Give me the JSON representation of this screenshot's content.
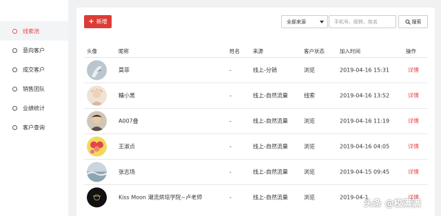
{
  "sidebar": {
    "items": [
      {
        "label": "线索池",
        "active": true
      },
      {
        "label": "意向客户",
        "active": false
      },
      {
        "label": "成交客户",
        "active": false
      },
      {
        "label": "销售团队",
        "active": false
      },
      {
        "label": "业绩统计",
        "active": false
      },
      {
        "label": "客户查询",
        "active": false
      }
    ]
  },
  "toolbar": {
    "add_label": "新增",
    "source_select": "全部来源",
    "search_placeholder": "手机号、昵称、姓名",
    "search_label": "搜索"
  },
  "table": {
    "headers": [
      "头像",
      "昵称",
      "姓名",
      "来源",
      "客户状态",
      "加入时间",
      "操作"
    ],
    "rows": [
      {
        "nickname": "莫菲",
        "name": "-",
        "source": "线上-分销",
        "status": "浏览",
        "joined": "2019-04-16 15:31",
        "action": "详情"
      },
      {
        "nickname": "糖小黑",
        "name": "-",
        "source": "线上-自然流量",
        "status": "线索",
        "joined": "2019-04-16 13:52",
        "action": "详情"
      },
      {
        "nickname": "A007叠",
        "name": "-",
        "source": "线上-自然流量",
        "status": "浏览",
        "joined": "2019-04-16 11:19",
        "action": "详情"
      },
      {
        "nickname": "王淑贞",
        "name": "-",
        "source": "线上-自然流量",
        "status": "浏览",
        "joined": "2019-04-16 04:05",
        "action": "详情"
      },
      {
        "nickname": "张志场",
        "name": "-",
        "source": "线上-自然流量",
        "status": "浏览",
        "joined": "2019-04-15 09:45",
        "action": "详情"
      },
      {
        "nickname": "Kiss Moon 潮流烘培学院~卢老师",
        "name": "-",
        "source": "线上-自然流量",
        "status": "浏览",
        "joined": "2019-04-1",
        "action": "详情"
      }
    ]
  },
  "watermark": "头条 @校满满",
  "colors": {
    "accent": "#dd3b35",
    "link": "#e5484d"
  }
}
